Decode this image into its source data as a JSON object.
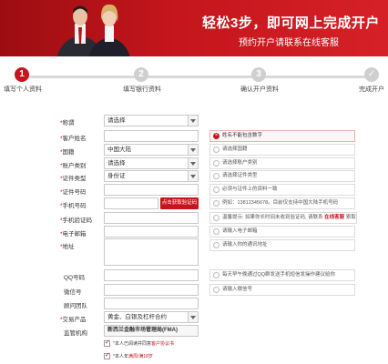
{
  "banner": {
    "title": "轻松3步，即可网上完成开户",
    "subtitle": "预约开户请联系在线客服"
  },
  "steps": [
    {
      "num": "1",
      "label": "填写个人资料",
      "active": true
    },
    {
      "num": "2",
      "label": "填写银行资料",
      "active": false
    },
    {
      "num": "3",
      "label": "确认开户资料",
      "active": false
    },
    {
      "num": "✓",
      "label": "完成开户",
      "active": false
    }
  ],
  "form": {
    "title_label": "称谓",
    "title_value": "请选择",
    "name_label": "客户姓名",
    "name_error": "姓名不能包含数字",
    "nationality_label": "国籍",
    "nationality_value": "中国大陆",
    "nationality_hint": "请选择国籍",
    "account_type_label": "账户类别",
    "account_type_value": "请选择",
    "account_type_hint": "请选择账户类别",
    "id_type_label": "证件类型",
    "id_type_value": "身份证",
    "id_type_hint": "请选择证件类型",
    "id_number_label": "证件号码",
    "id_number_hint": "必须与证件上的资料一致",
    "phone_label": "手机号码",
    "get_code_button": "点击获取验证码",
    "phone_hint": "例如：13812345678。目前仅支持中国大陆手机号码",
    "code_label": "手机验证码",
    "code_hint_prefix": "温馨提示: 如果你长时间未收到验证码, 请联系 ",
    "code_hint_link": "在线客服",
    "code_hint_suffix": " 索取",
    "email_label": "电子邮箱",
    "email_hint": "请输入电子邮箱",
    "address_label": "地址",
    "address_hint": "请输入你的通讯地址",
    "qq_label": "QQ号码",
    "qq_hint": "每天早午晚通过QQ群发送手机短信发操作建议给你",
    "wechat_label": "微信号",
    "wechat_hint": "请输入微信号",
    "team_label": "顾问团队",
    "product_label": "交易产品",
    "product_value": "黄金、白银及杠杆合约",
    "regulator_label": "监管机构",
    "regulator_value": "新西兰金融市场管理局(FMA)",
    "agree1_prefix": "本人已阅读并同意",
    "agree1_link": "客户协议书",
    "agree2_prefix": "本人年",
    "agree2_link": "满周/满18岁"
  },
  "colors": {
    "brand_red": "#c4161c"
  }
}
